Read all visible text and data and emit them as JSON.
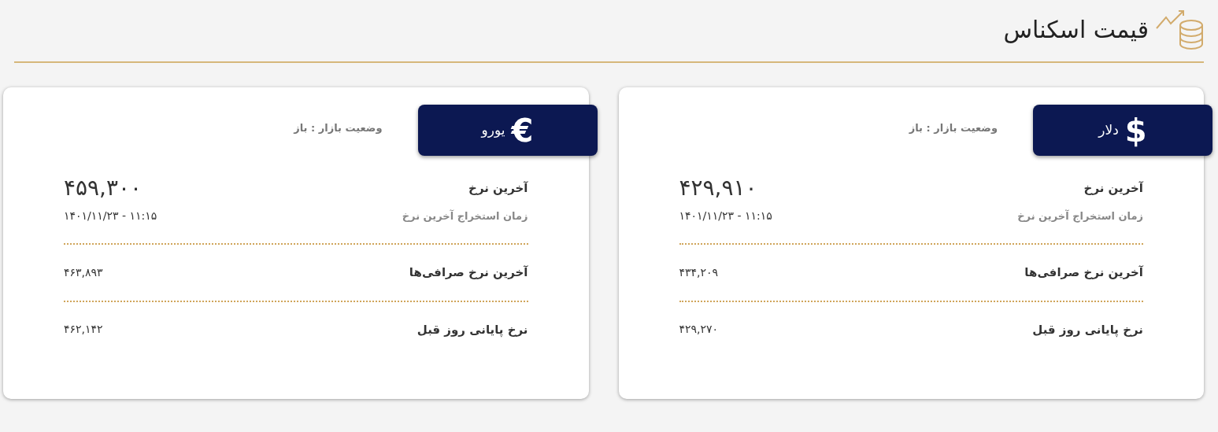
{
  "header": {
    "title": "قیمت اسکناس"
  },
  "cards": [
    {
      "currency": "دلار",
      "symbol": "$",
      "market_status": "وضعیت بازار : باز",
      "last_rate_label": "آخرین نرخ",
      "last_rate": "۴۲۹,۹۱۰",
      "time_label": "زمان استخراج آخرین نرخ",
      "time": "۱۱:۱۵ - ۱۴۰۱/۱۱/۲۳",
      "exchange_label": "آخرین نرخ صرافی‌ها",
      "exchange_rate": "۴۳۴,۲۰۹",
      "prev_label": "نرخ پایانی روز قبل",
      "prev_rate": "۴۲۹,۲۷۰"
    },
    {
      "currency": "یورو",
      "symbol": "€",
      "market_status": "وضعیت بازار : باز",
      "last_rate_label": "آخرین نرخ",
      "last_rate": "۴۵۹,۳۰۰",
      "time_label": "زمان استخراج آخرین نرخ",
      "time": "۱۱:۱۵ - ۱۴۰۱/۱۱/۲۳",
      "exchange_label": "آخرین نرخ صرافی‌ها",
      "exchange_rate": "۴۶۳,۸۹۳",
      "prev_label": "نرخ پایانی روز قبل",
      "prev_rate": "۴۶۲,۱۴۲"
    }
  ]
}
